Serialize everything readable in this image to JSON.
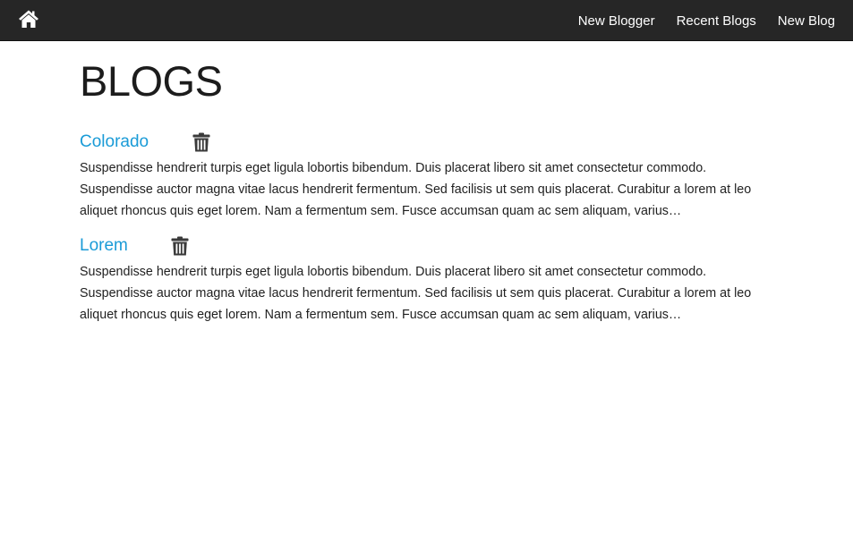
{
  "navbar": {
    "home_icon": "home-icon",
    "links": [
      {
        "label": "New Blogger"
      },
      {
        "label": "Recent Blogs"
      },
      {
        "label": "New Blog"
      }
    ]
  },
  "main": {
    "title": "BLOGS",
    "blogs": [
      {
        "title": "Colorado",
        "delete_icon": "trash-icon",
        "excerpt": "Suspendisse hendrerit turpis eget ligula lobortis bibendum. Duis placerat libero sit amet consectetur commodo. Suspendisse auctor magna vitae lacus hendrerit fermentum. Sed facilisis ut sem quis placerat. Curabitur a lorem at leo aliquet rhoncus quis eget lorem. Nam a fermentum sem. Fusce accumsan quam ac sem aliquam, varius…"
      },
      {
        "title": "Lorem",
        "delete_icon": "trash-icon",
        "excerpt": "Suspendisse hendrerit turpis eget ligula lobortis bibendum. Duis placerat libero sit amet consectetur commodo. Suspendisse auctor magna vitae lacus hendrerit fermentum. Sed facilisis ut sem quis placerat. Curabitur a lorem at leo aliquet rhoncus quis eget lorem. Nam a fermentum sem. Fusce accumsan quam ac sem aliquam, varius…"
      }
    ]
  },
  "colors": {
    "navbar_bg": "#262626",
    "link_blue": "#1a9bd7",
    "icon_gray": "#3a3a3a"
  }
}
